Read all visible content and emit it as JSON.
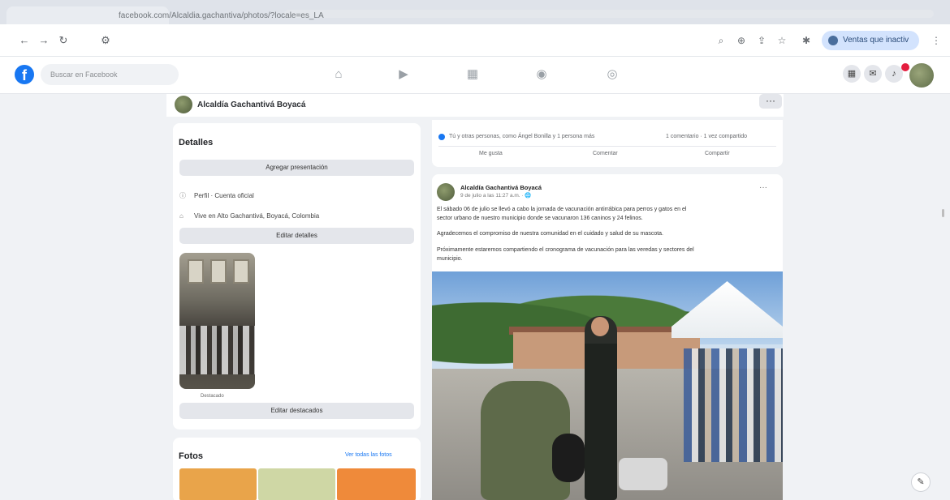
{
  "browser": {
    "url": "facebook.com/Alcaldia.gachantiva/photos/?locale=es_LA",
    "profile_label": "Ventas que inactiv"
  },
  "fb": {
    "search_placeholder": "Buscar en Facebook"
  },
  "profile": {
    "name": "Alcaldía Gachantivá Boyacá",
    "more_label": "···"
  },
  "details": {
    "title": "Detalles",
    "add_intro": "Agregar presentación",
    "page_type": "Perfil · Cuenta oficial",
    "lives_in": "Vive en Alto Gachantivá, Boyacá, Colombia",
    "edit_details": "Editar detalles",
    "photo_caption": "Destacado",
    "edit_featured": "Editar destacados"
  },
  "photos": {
    "title": "Fotos",
    "see_all": "Ver todas las fotos"
  },
  "prev_post": {
    "reactions_text": "Tú y otras personas, como Ángel Bonilla y 1 persona más",
    "counts": "1 comentario · 1 vez compartido",
    "like": "Me gusta",
    "comment": "Comentar",
    "share": "Compartir"
  },
  "post": {
    "author": "Alcaldía Gachantivá Boyacá",
    "date": "9 de julio a las 11:27 a.m. · 🌐",
    "more": "···",
    "lines": [
      "El sábado 06 de julio se llevó a cabo la jornada de vacunación antirrábica para perros y gatos en el",
      "sector urbano de nuestro municipio donde se vacunaron 136 caninos y 24 felinos.",
      "Agradecemos el compromiso de nuestra comunidad en el cuidado y salud de su mascota.",
      "Próximamente estaremos compartiendo el cronograma de vacunación para las veredas y sectores del",
      "municipio."
    ]
  }
}
